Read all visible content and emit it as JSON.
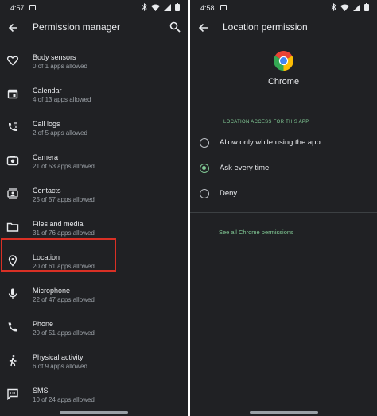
{
  "left": {
    "status": {
      "time": "4:57"
    },
    "title": "Permission manager",
    "items": [
      {
        "name": "Body sensors",
        "count": "0 of 1 apps allowed",
        "icon": "heart-icon"
      },
      {
        "name": "Calendar",
        "count": "4 of 13 apps allowed",
        "icon": "calendar-icon"
      },
      {
        "name": "Call logs",
        "count": "2 of 5 apps allowed",
        "icon": "call-log-icon"
      },
      {
        "name": "Camera",
        "count": "21 of 53 apps allowed",
        "icon": "camera-icon"
      },
      {
        "name": "Contacts",
        "count": "25 of 57 apps allowed",
        "icon": "contacts-icon"
      },
      {
        "name": "Files and media",
        "count": "31 of 76 apps allowed",
        "icon": "folder-icon"
      },
      {
        "name": "Location",
        "count": "20 of 61 apps allowed",
        "icon": "location-pin-icon"
      },
      {
        "name": "Microphone",
        "count": "22 of 47 apps allowed",
        "icon": "microphone-icon"
      },
      {
        "name": "Phone",
        "count": "20 of 51 apps allowed",
        "icon": "phone-icon"
      },
      {
        "name": "Physical activity",
        "count": "6 of 9 apps allowed",
        "icon": "walking-icon"
      },
      {
        "name": "SMS",
        "count": "10 of 24 apps allowed",
        "icon": "sms-icon"
      }
    ]
  },
  "right": {
    "status": {
      "time": "4:58"
    },
    "title": "Location permission",
    "app_name": "Chrome",
    "section_header": "LOCATION ACCESS FOR THIS APP",
    "options": [
      {
        "label": "Allow only while using the app",
        "selected": false
      },
      {
        "label": "Ask every time",
        "selected": true
      },
      {
        "label": "Deny",
        "selected": false
      }
    ],
    "see_all": "See all Chrome permissions"
  },
  "colors": {
    "background": "#202124",
    "accent": "#81c995",
    "highlight_box": "#d93025",
    "secondary_text": "#9aa0a6"
  }
}
